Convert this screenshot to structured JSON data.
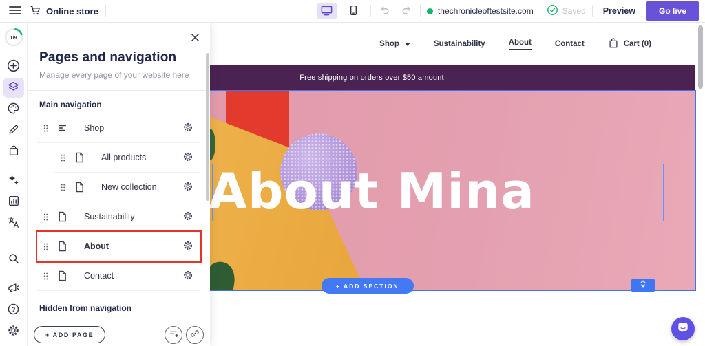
{
  "topbar": {
    "app_label": "Online store",
    "domain": "thechronicleoftestsite.com",
    "saved_label": "Saved",
    "preview_label": "Preview",
    "go_live_label": "Go live"
  },
  "sidebar": {
    "progress_label": "1/9",
    "icons": [
      "add",
      "pages",
      "theme",
      "edit",
      "store",
      "ai",
      "analytics",
      "translate",
      "search",
      "marketing",
      "help",
      "settings"
    ],
    "selected_icon": "pages"
  },
  "panel": {
    "title": "Pages and navigation",
    "subtitle": "Manage every page of your website here",
    "main_section_label": "Main navigation",
    "hidden_section_label": "Hidden from navigation",
    "items": [
      {
        "label": "Shop",
        "type": "menu"
      },
      {
        "label": "All products",
        "type": "page",
        "child": true
      },
      {
        "label": "New collection",
        "type": "page",
        "child": true
      },
      {
        "label": "Sustainability",
        "type": "page"
      },
      {
        "label": "About",
        "type": "page",
        "highlighted": true
      },
      {
        "label": "Contact",
        "type": "page"
      }
    ],
    "add_page_label": "+  ADD PAGE"
  },
  "site": {
    "nav": {
      "shop": "Shop",
      "sustainability": "Sustainability",
      "about": "About",
      "contact": "Contact",
      "cart": "Cart (0)"
    },
    "active_nav": "About",
    "banner_text": "Free shipping on orders over $50 amount",
    "hero_title": "About Mina",
    "add_section_label": "+   ADD SECTION"
  },
  "colors": {
    "accent_purple": "#6a52d8",
    "selection_blue": "#3f72f2",
    "banner_purple": "#4a2352",
    "hero_pink": "#e4a0b0",
    "highlight_red": "#e8332a",
    "status_green": "#17b26a",
    "chat_purple": "#6051e6"
  }
}
